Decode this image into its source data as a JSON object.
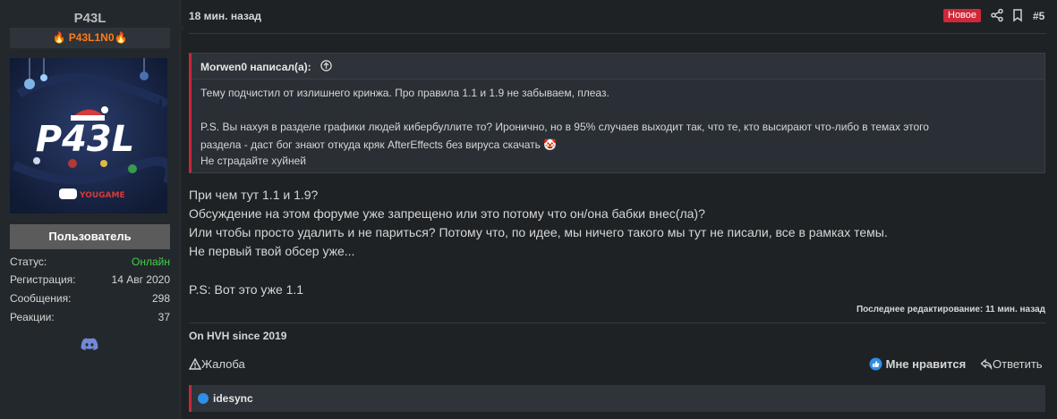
{
  "user": {
    "name": "P43L",
    "title": "🔥 P43L1N0🔥",
    "avatar_text": "P43L",
    "avatar_brand": "YOUGAME",
    "role": "Пользователь",
    "stats": [
      {
        "label": "Статус:",
        "value": "Онлайн"
      },
      {
        "label": "Регистрация:",
        "value": "14 Авг 2020"
      },
      {
        "label": "Сообщения:",
        "value": "298"
      },
      {
        "label": "Реакции:",
        "value": "37"
      }
    ]
  },
  "post": {
    "time": "18 мин. назад",
    "badge": "Новое",
    "number": "#5",
    "quote": {
      "author": "Morwen0 написал(а):",
      "lines": [
        "Тему подчистил от излишнего кринжа. Про правила 1.1 и 1.9 не забываем, плеаз.",
        "P.S. Вы нахуя в разделе графики людей кибербуллите то? Иронично, но в 95% случаев выходит так, что те, кто высирают что-либо в темах этого",
        "раздела - даст бог знают откуда кряк AfterEffects без вируса скачать 🤡",
        "Не страдайте хуйней"
      ]
    },
    "body": [
      "При чем тут 1.1 и 1.9?",
      "Обсуждение на этом форуме уже запрещено или это потому что он/она бабки внес(ла)?",
      "Или чтобы просто удалить и не париться? Потому что, по идее, мы ничего такого мы тут не писали, все в рамках темы.",
      "Не первый твой обсер уже...",
      "P.S: Вот это уже 1.1"
    ],
    "edited": "Последнее редактирование: 11 мин. назад",
    "signature": "On HVH since 2019",
    "actions": {
      "report": "Жалоба",
      "like": "Мне нравится",
      "reply": "Ответить"
    },
    "likes": "idesync"
  },
  "colors": {
    "accent_red": "#c8283b",
    "online_green": "#44d04a",
    "title_orange": "#ff7a1a",
    "like_blue": "#2f8fe6"
  }
}
